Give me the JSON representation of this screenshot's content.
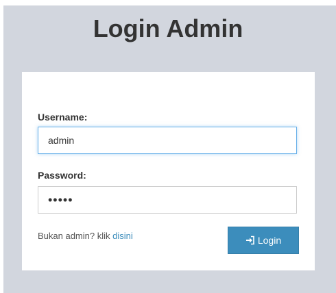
{
  "page": {
    "title": "Login Admin"
  },
  "form": {
    "username_label": "Username:",
    "username_value": "admin",
    "password_label": "Password:",
    "password_value": "•••••",
    "note_text": "Bukan admin? klik ",
    "note_link": "disini",
    "login_label": "Login",
    "login_icon": "sign-in-icon"
  },
  "colors": {
    "background": "#d2d6de",
    "primary": "#3c8dbc",
    "focus_border": "#66afe9"
  }
}
